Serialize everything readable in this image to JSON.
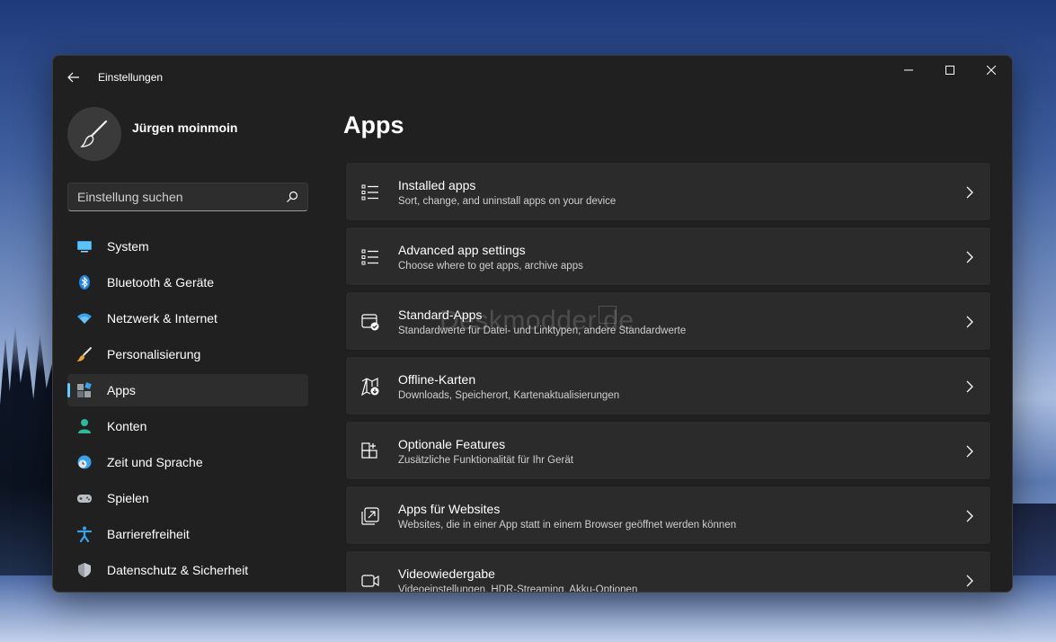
{
  "window": {
    "title": "Einstellungen"
  },
  "user": {
    "name": "Jürgen moinmoin"
  },
  "search": {
    "placeholder": "Einstellung suchen"
  },
  "sidebar": {
    "items": [
      {
        "label": "System",
        "icon": "system-icon"
      },
      {
        "label": "Bluetooth & Geräte",
        "icon": "bluetooth-icon"
      },
      {
        "label": "Netzwerk & Internet",
        "icon": "wifi-icon"
      },
      {
        "label": "Personalisierung",
        "icon": "brush-icon"
      },
      {
        "label": "Apps",
        "icon": "apps-icon",
        "active": true
      },
      {
        "label": "Konten",
        "icon": "account-icon"
      },
      {
        "label": "Zeit und Sprache",
        "icon": "globe-clock-icon"
      },
      {
        "label": "Spielen",
        "icon": "gamepad-icon"
      },
      {
        "label": "Barrierefreiheit",
        "icon": "accessibility-icon"
      },
      {
        "label": "Datenschutz & Sicherheit",
        "icon": "shield-icon"
      }
    ]
  },
  "main": {
    "title": "Apps",
    "cards": [
      {
        "title": "Installed apps",
        "subtitle": "Sort, change, and uninstall apps on your device",
        "icon": "list-icon"
      },
      {
        "title": "Advanced app settings",
        "subtitle": "Choose where to get apps, archive apps",
        "icon": "list-icon"
      },
      {
        "title": "Standard-Apps",
        "subtitle": "Standardwerte für Datei- und Linktypen, andere Standardwerte",
        "icon": "default-apps-icon"
      },
      {
        "title": "Offline-Karten",
        "subtitle": "Downloads, Speicherort, Kartenaktualisierungen",
        "icon": "map-download-icon"
      },
      {
        "title": "Optionale Features",
        "subtitle": "Zusätzliche Funktionalität für Ihr Gerät",
        "icon": "add-feature-icon"
      },
      {
        "title": "Apps für Websites",
        "subtitle": "Websites, die in einer App statt in einem Browser geöffnet werden können",
        "icon": "open-in-app-icon"
      },
      {
        "title": "Videowiedergabe",
        "subtitle": "Videoeinstellungen, HDR-Streaming, Akku-Optionen",
        "icon": "video-icon"
      }
    ]
  },
  "watermark": {
    "text": "Deskmodder.de"
  },
  "colors": {
    "accent": "#60cdff",
    "window_bg": "#202020",
    "card_bg": "#2b2b2b"
  }
}
